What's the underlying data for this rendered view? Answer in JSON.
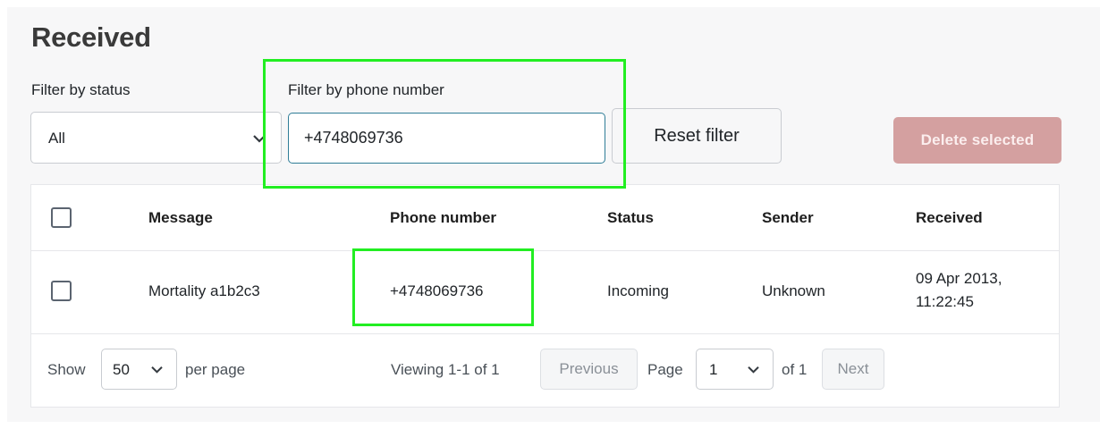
{
  "page": {
    "title": "Received"
  },
  "filters": {
    "status_label": "Filter by status",
    "status_value": "All",
    "phone_label": "Filter by phone number",
    "phone_value": "+4748069736",
    "reset_label": "Reset filter"
  },
  "actions": {
    "delete_label": "Delete selected"
  },
  "table": {
    "columns": [
      "Message",
      "Phone number",
      "Status",
      "Sender",
      "Received"
    ],
    "rows": [
      {
        "message": "Mortality a1b2c3",
        "phone": "+4748069736",
        "status": "Incoming",
        "sender": "Unknown",
        "received_date": "09 Apr 2013,",
        "received_time": "11:22:45"
      }
    ]
  },
  "pagination": {
    "show_label": "Show",
    "per_page_value": "50",
    "per_page_label": "per page",
    "viewing": "Viewing 1-1 of 1",
    "previous_label": "Previous",
    "page_label": "Page",
    "page_value": "1",
    "of_label": "of 1",
    "next_label": "Next"
  },
  "colors": {
    "highlight": "#22ee22",
    "delete_button": "#d4a0a0",
    "input_focus_border": "#2f7d97"
  },
  "icons": [
    "chevron-down-icon",
    "checkbox-icon"
  ]
}
